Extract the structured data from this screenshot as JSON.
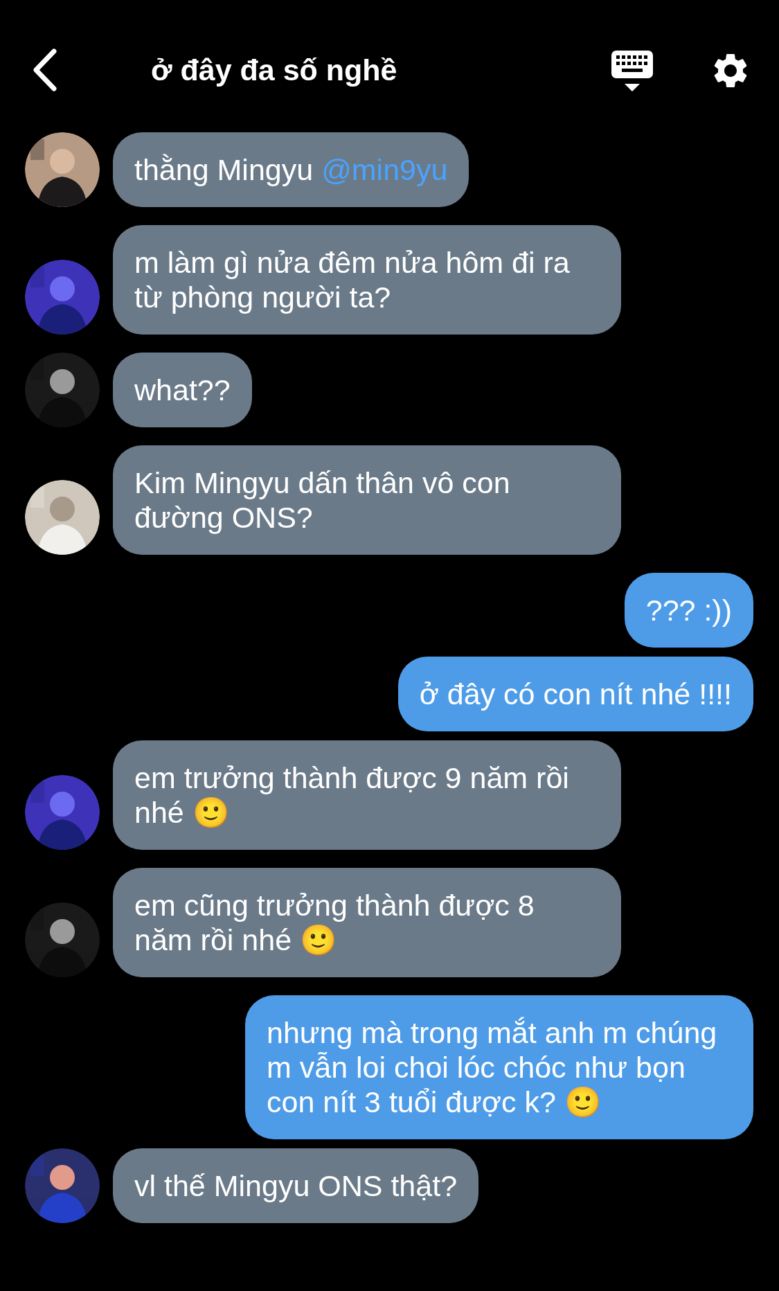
{
  "header": {
    "title": "ở đây đa số nghề"
  },
  "messages": [
    {
      "kind": "received",
      "text": "thằng Mingyu ",
      "mention": "@min9yu"
    },
    {
      "kind": "received",
      "text": "m làm gì nửa đêm nửa hôm đi ra từ phòng người ta?"
    },
    {
      "kind": "received",
      "text": "what??"
    },
    {
      "kind": "received",
      "text": "Kim Mingyu dấn thân vô con đường ONS?"
    },
    {
      "kind": "sent",
      "text": "??? :))"
    },
    {
      "kind": "sent",
      "text": "ở đây có con nít nhé !!!!"
    },
    {
      "kind": "received",
      "text": "em trưởng thành được 9 năm rồi nhé 🙂"
    },
    {
      "kind": "received",
      "text": "em cũng trưởng thành được 8 năm rồi nhé 🙂"
    },
    {
      "kind": "sent",
      "text": "nhưng mà trong mắt anh m chúng m vẫn loi choi lóc chóc như bọn con nít 3 tuổi được k? 🙂"
    },
    {
      "kind": "received",
      "text": "vl thế Mingyu ONS thật?"
    }
  ]
}
